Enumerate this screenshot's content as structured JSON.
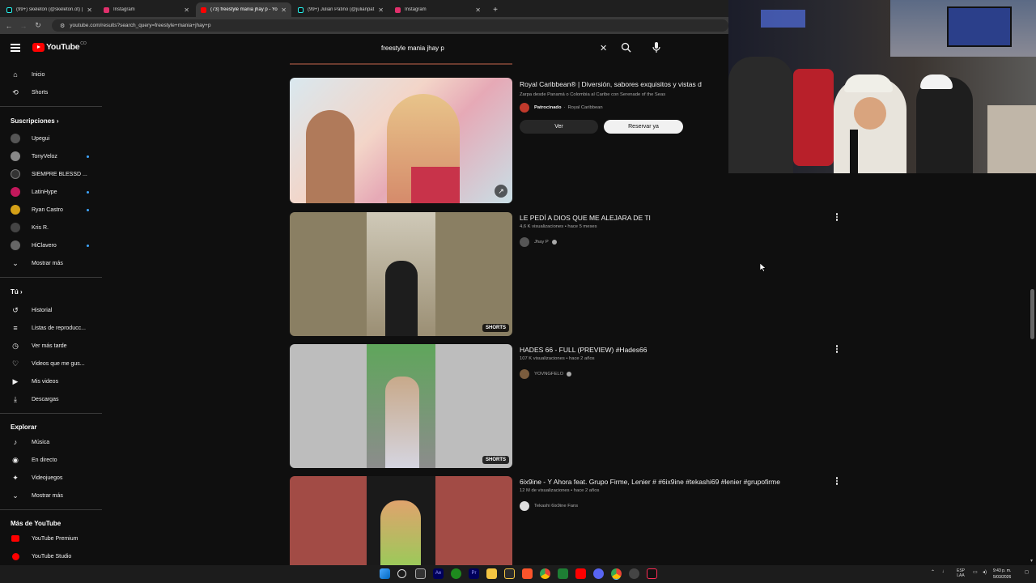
{
  "browser": {
    "tabs": [
      {
        "title": "(99+) skeleton (@skeleton.ot) | T",
        "color": "#25f4ee"
      },
      {
        "title": "Instagram",
        "color": "#e1306c"
      },
      {
        "title": "(73) freestyle mania jhay p - Yo",
        "color": "#ff0000",
        "active": true
      },
      {
        "title": "(99+) Julián Patiño (@julianpat",
        "color": "#25f4ee"
      },
      {
        "title": "Instagram",
        "color": "#e1306c"
      }
    ],
    "new_tab": "+",
    "url": "youtube.com/results?search_query=freestyle+mania+jhay+p"
  },
  "youtube": {
    "logo_text": "YouTube",
    "logo_country": "CO",
    "search_value": "freestyle mania jhay p"
  },
  "sidebar": {
    "main": [
      {
        "label": "Inicio",
        "icon": "home-icon"
      },
      {
        "label": "Shorts",
        "icon": "shorts-icon"
      }
    ],
    "subs_header": "Suscripciones",
    "subs": [
      {
        "label": "Upegui",
        "dot": false,
        "color": "#555"
      },
      {
        "label": "TonyVeloz",
        "dot": true,
        "color": "#888"
      },
      {
        "label": "SIEMPRE BLESSD ...",
        "dot": false,
        "color": "#333"
      },
      {
        "label": "LatinHype",
        "dot": true,
        "color": "#c2185b"
      },
      {
        "label": "Ryan Castro",
        "dot": true,
        "color": "#d4a017"
      },
      {
        "label": "Kris R.",
        "dot": false,
        "color": "#444"
      },
      {
        "label": "HiClavero",
        "dot": true,
        "color": "#666"
      }
    ],
    "subs_more": "Mostrar más",
    "you_header": "Tú",
    "you": [
      {
        "label": "Historial",
        "icon": "history-icon"
      },
      {
        "label": "Listas de reproducc...",
        "icon": "playlist-icon"
      },
      {
        "label": "Ver más tarde",
        "icon": "clock-icon"
      },
      {
        "label": "Videos que me gus...",
        "icon": "like-icon"
      },
      {
        "label": "Mis videos",
        "icon": "video-icon"
      },
      {
        "label": "Descargas",
        "icon": "download-icon"
      }
    ],
    "explore_header": "Explorar",
    "explore": [
      {
        "label": "Música",
        "icon": "music-icon"
      },
      {
        "label": "En directo",
        "icon": "live-icon"
      },
      {
        "label": "Videojuegos",
        "icon": "gaming-icon"
      }
    ],
    "explore_more": "Mostrar más",
    "more_header": "Más de YouTube",
    "more": [
      {
        "label": "YouTube Premium"
      },
      {
        "label": "YouTube Studio"
      }
    ]
  },
  "results": {
    "ad": {
      "title": "Royal Caribbean® | Diversión, sabores exquisitos y vistas d",
      "description": "Zarpa desde Panamá o Colombia al Caribe con Serenade of the Seas",
      "sponsored": "Patrocinado",
      "advertiser": "Royal Caribbean",
      "button_view": "Ver",
      "button_book": "Reservar ya"
    },
    "videos": [
      {
        "title": "LE PEDÍ A DIOS QUE ME ALEJARA DE TI",
        "meta": "4,6 K visualizaciones • hace 5 meses",
        "channel": "Jhay P",
        "badge": "SHORTS"
      },
      {
        "title": "HADES 66 - FULL (PREVIEW) #Hades66",
        "meta": "107 K visualizaciones • hace 2 años",
        "channel": "YOVNGFELO",
        "badge": "SHORTS"
      },
      {
        "title": "6ix9ine - Y Ahora feat. Grupo Firme, Lenier # #6ix9ine #tekashi69 #lenier #grupofirme",
        "meta": "12 M de visualizaciones • hace 2 años",
        "channel": "Tekashi 6ix9ine Fans",
        "badge": ""
      }
    ]
  },
  "taskbar": {
    "lang_top": "ESP",
    "lang_bottom": "LAA",
    "time": "9:43 p. m.",
    "date": "5/03/2026"
  }
}
